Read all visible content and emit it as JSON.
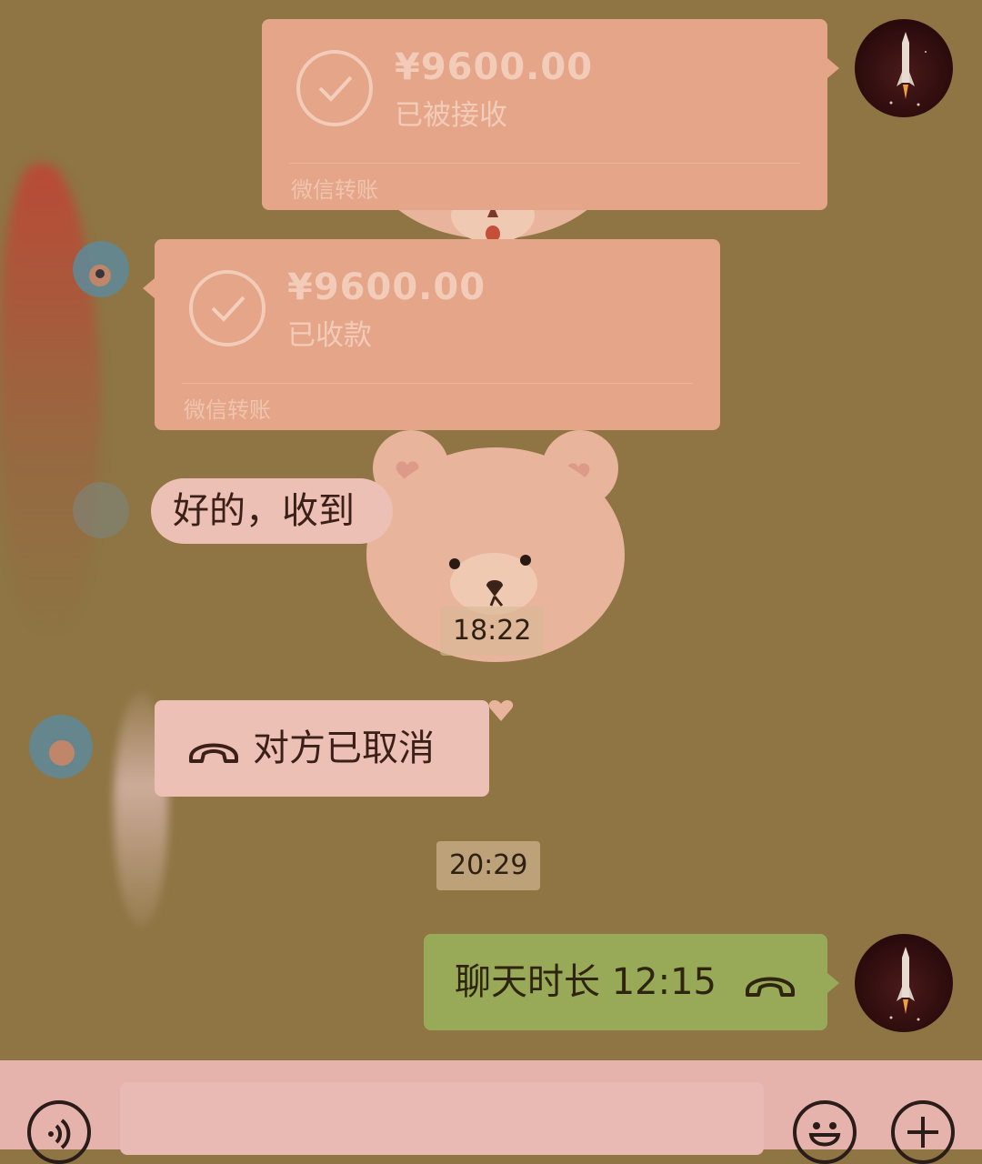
{
  "messages": {
    "transfer_sent": {
      "amount": "¥9600.00",
      "status": "已被接收",
      "label": "微信转账"
    },
    "transfer_received": {
      "amount": "¥9600.00",
      "status": "已收款",
      "label": "微信转账"
    },
    "reply_text": "好的，收到",
    "call_cancelled": "对方已取消",
    "time_1": "18:22",
    "time_2": "20:29",
    "call_duration": "聊天时长 12:15"
  },
  "icons": {
    "check": "check-circle-icon",
    "phone": "phone-hangup-icon",
    "voice": "voice-icon",
    "emoji": "emoji-icon",
    "plus": "plus-icon"
  },
  "colors": {
    "background": "#8e7543",
    "transfer_card": "#e4a588",
    "incoming_bubble": "#edc0b5",
    "outgoing_bubble": "#98aa57",
    "input_bar": "#e6b3ac"
  }
}
